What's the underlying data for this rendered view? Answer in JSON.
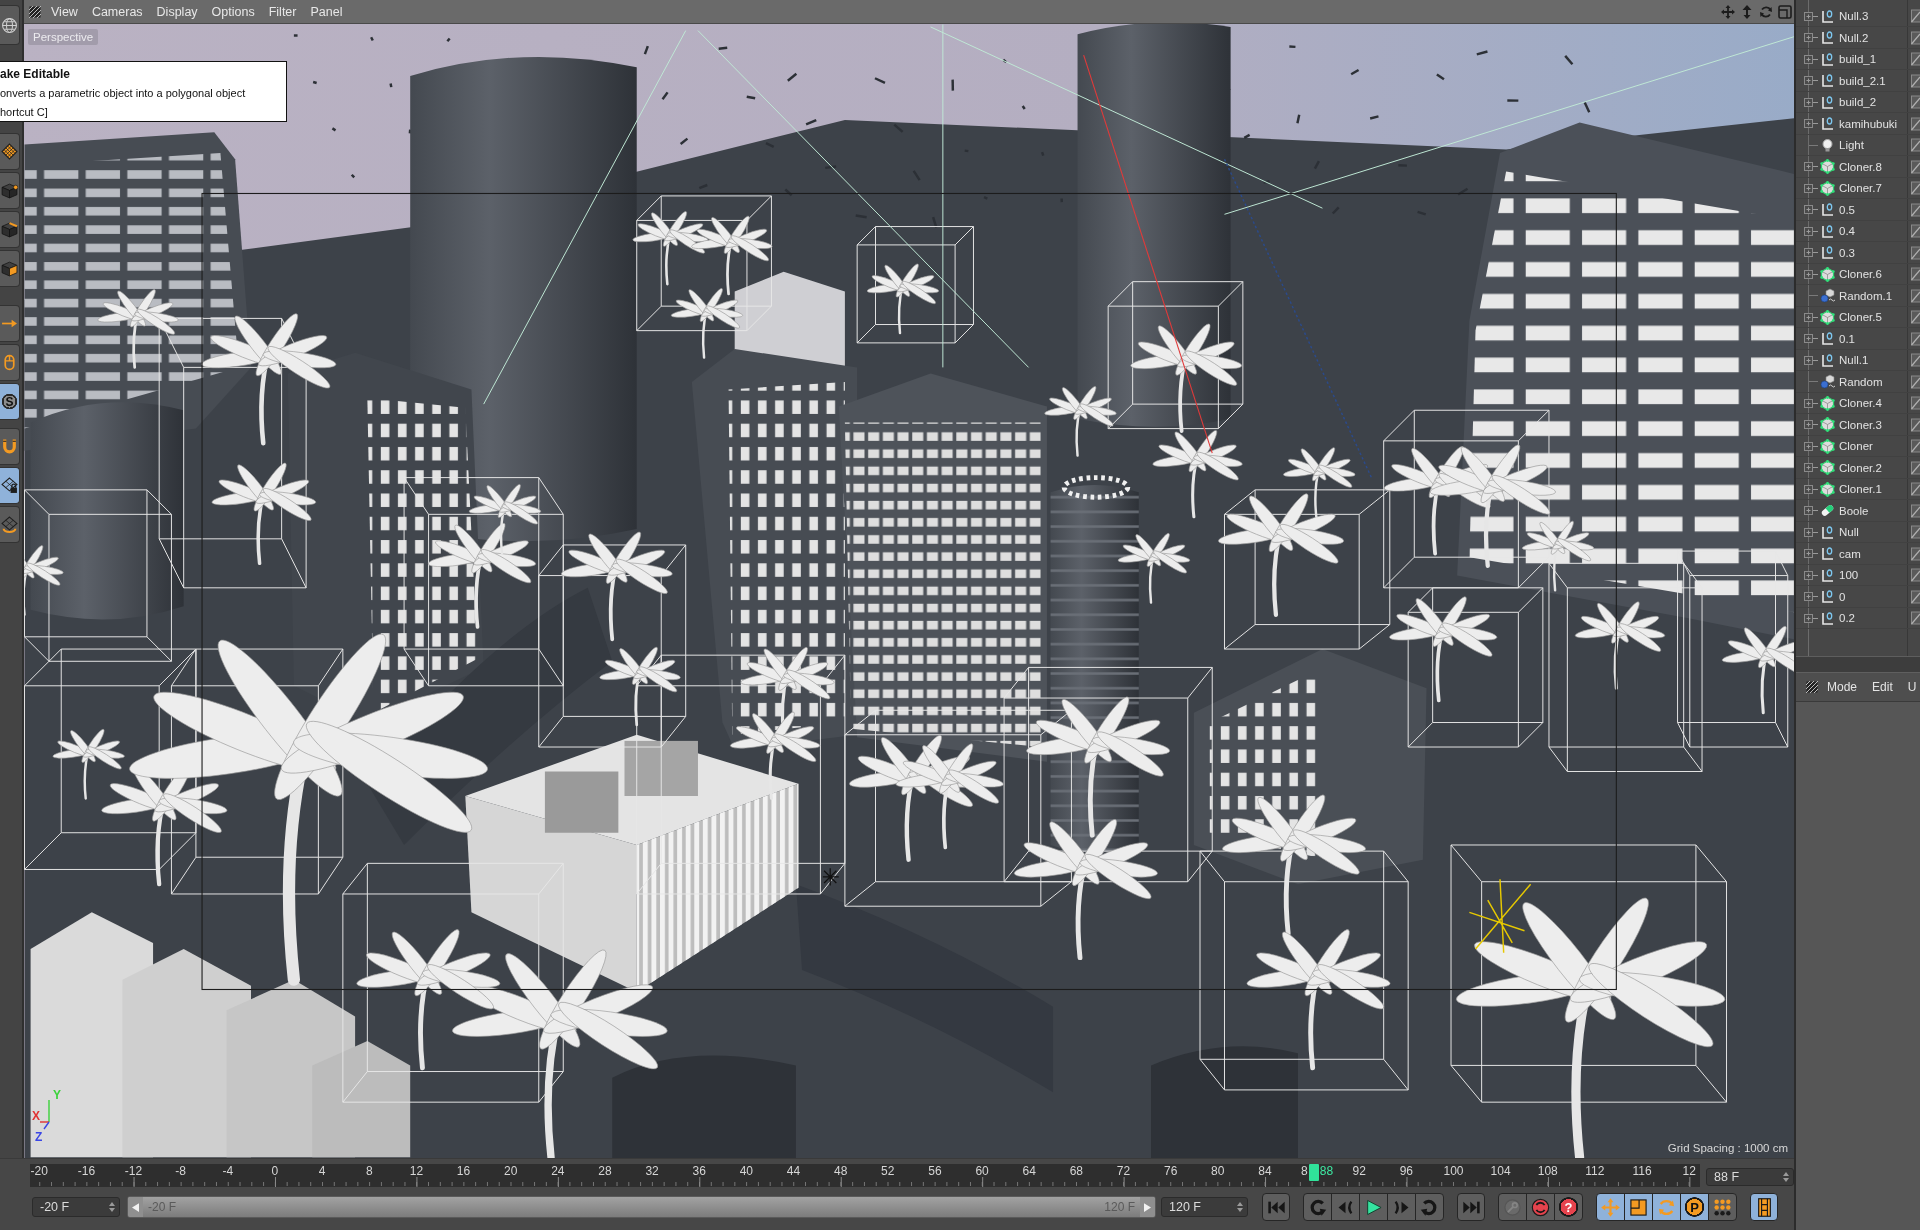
{
  "left_toolbar": {
    "groups": [
      {
        "tools": [
          {
            "kind": "sphere",
            "on": false
          }
        ]
      },
      {
        "tools": [
          {
            "kind": "model",
            "on": false
          },
          {
            "kind": "points",
            "on": false
          },
          {
            "kind": "edges",
            "on": false
          },
          {
            "kind": "polygons",
            "on": false
          }
        ]
      },
      {
        "tools": [
          {
            "kind": "axis",
            "on": false
          },
          {
            "kind": "tweak",
            "on": false
          },
          {
            "kind": "snap",
            "label": "S",
            "on": true
          }
        ]
      },
      {
        "tools": [
          {
            "kind": "magnet",
            "on": false
          },
          {
            "kind": "workplane-lock",
            "on": true
          },
          {
            "kind": "workplane-rotate",
            "on": false
          }
        ]
      }
    ]
  },
  "viewport": {
    "menu": [
      "View",
      "Cameras",
      "Display",
      "Options",
      "Filter",
      "Panel"
    ],
    "camera": "Perspective",
    "grid_spacing": "Grid Spacing : 1000 cm",
    "axes": [
      {
        "label": "Y",
        "color": "#3bd23b"
      },
      {
        "label": "X",
        "color": "#e03232"
      },
      {
        "label": "Z",
        "color": "#3a46e6"
      }
    ]
  },
  "tooltip": {
    "title": "ake Editable",
    "lines": [
      "onverts a parametric object into a polygonal object",
      "hortcut C]"
    ]
  },
  "object_manager": {
    "objects": [
      {
        "name": "Null.3",
        "kind": "null",
        "expandable": true
      },
      {
        "name": "Null.2",
        "kind": "null",
        "expandable": true
      },
      {
        "name": "build_1",
        "kind": "null",
        "expandable": true
      },
      {
        "name": "build_2.1",
        "kind": "null",
        "expandable": true
      },
      {
        "name": "build_2",
        "kind": "null",
        "expandable": true
      },
      {
        "name": "kamihubuki",
        "kind": "null",
        "expandable": true
      },
      {
        "name": "Light",
        "kind": "light",
        "expandable": false
      },
      {
        "name": "Cloner.8",
        "kind": "cloner",
        "expandable": true
      },
      {
        "name": "Cloner.7",
        "kind": "cloner",
        "expandable": true
      },
      {
        "name": "0.5",
        "kind": "null",
        "expandable": true
      },
      {
        "name": "0.4",
        "kind": "null",
        "expandable": true
      },
      {
        "name": "0.3",
        "kind": "null",
        "expandable": true
      },
      {
        "name": "Cloner.6",
        "kind": "cloner",
        "expandable": true
      },
      {
        "name": "Random.1",
        "kind": "effector",
        "expandable": false
      },
      {
        "name": "Cloner.5",
        "kind": "cloner",
        "expandable": true
      },
      {
        "name": "0.1",
        "kind": "null",
        "expandable": true
      },
      {
        "name": "Null.1",
        "kind": "null",
        "expandable": true
      },
      {
        "name": "Random",
        "kind": "effector",
        "expandable": false
      },
      {
        "name": "Cloner.4",
        "kind": "cloner",
        "expandable": true
      },
      {
        "name": "Cloner.3",
        "kind": "cloner",
        "expandable": true
      },
      {
        "name": "Cloner",
        "kind": "cloner",
        "expandable": true
      },
      {
        "name": "Cloner.2",
        "kind": "cloner",
        "expandable": true
      },
      {
        "name": "Cloner.1",
        "kind": "cloner",
        "expandable": true
      },
      {
        "name": "Boole",
        "kind": "boole",
        "expandable": true
      },
      {
        "name": "Null",
        "kind": "null",
        "expandable": true
      },
      {
        "name": "cam",
        "kind": "null",
        "expandable": true
      },
      {
        "name": "100",
        "kind": "null",
        "expandable": true
      },
      {
        "name": "0",
        "kind": "null",
        "expandable": true
      },
      {
        "name": "0.2",
        "kind": "null",
        "expandable": true
      }
    ]
  },
  "attributes": {
    "menu": [
      "Mode",
      "Edit",
      "U"
    ]
  },
  "timeline": {
    "ruler_labels": [
      "-20",
      "-16",
      "-12",
      "-8",
      "-4",
      "0",
      "4",
      "8",
      "12",
      "16",
      "20",
      "24",
      "28",
      "32",
      "36",
      "40",
      "44",
      "48",
      "52",
      "56",
      "60",
      "64",
      "68",
      "72",
      "76",
      "80",
      "84",
      "8",
      "92",
      "96",
      "100",
      "104",
      "108",
      "112",
      "116",
      "12"
    ],
    "playhead": {
      "label": "88",
      "level": 0.7714
    },
    "frame_field": "88 F",
    "start_field": "-20 F",
    "range": {
      "start_label": "-20 F",
      "end_label": "120 F",
      "level": 1
    },
    "end_field": "120 F",
    "button_groups": [
      {
        "buttons": [
          {
            "kind": "goto-start",
            "on": false
          }
        ]
      },
      {
        "buttons": [
          {
            "kind": "prev-key",
            "on": false
          },
          {
            "kind": "prev-frame",
            "on": false
          },
          {
            "kind": "play",
            "on": false
          },
          {
            "kind": "next-frame",
            "on": false
          },
          {
            "kind": "next-key",
            "on": false
          }
        ]
      },
      {
        "buttons": [
          {
            "kind": "goto-end",
            "on": false
          }
        ]
      },
      {
        "buttons": [
          {
            "kind": "key",
            "on": false
          },
          {
            "kind": "record",
            "on": false
          },
          {
            "kind": "autokey",
            "label": "?",
            "on": false
          }
        ]
      },
      {
        "buttons": [
          {
            "kind": "move",
            "on": true
          },
          {
            "kind": "scale",
            "on": true
          },
          {
            "kind": "rotate",
            "on": true
          },
          {
            "kind": "parameter",
            "label": "P",
            "on": true
          },
          {
            "kind": "point-level",
            "on": false
          }
        ]
      },
      {
        "buttons": [
          {
            "kind": "timeline",
            "on": true
          }
        ]
      }
    ]
  }
}
